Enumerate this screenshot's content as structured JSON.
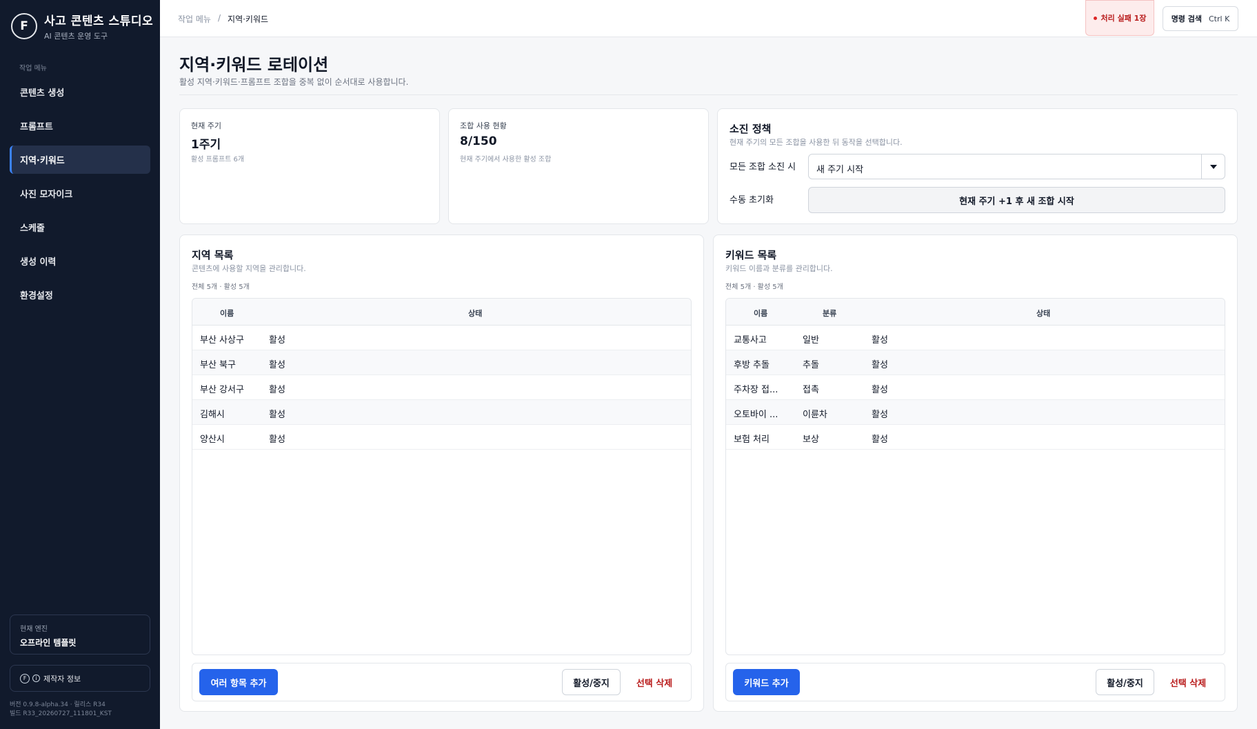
{
  "app": {
    "logo_text": "F",
    "title": "사고 콘텐츠 스튜디오",
    "subtitle": "AI 콘텐츠 운영 도구"
  },
  "sidebar": {
    "section_label": "작업 메뉴",
    "items": [
      {
        "label": "콘텐츠 생성"
      },
      {
        "label": "프롬프트"
      },
      {
        "label": "지역·키워드"
      },
      {
        "label": "사진 모자이크"
      },
      {
        "label": "스케줄"
      },
      {
        "label": "생성 이력"
      },
      {
        "label": "환경설정"
      }
    ],
    "active_index": 2,
    "engine_label": "현재 엔진",
    "engine_value": "오프라인 템플릿",
    "maker_label": "제작자 정보",
    "version_line1": "버전 0.9.8-alpha.34 · 릴리스 R34",
    "version_line2": "빌드 R33_20260727_111801_KST"
  },
  "topbar": {
    "breadcrumb_parent": "작업 메뉴",
    "breadcrumb_sep": "/",
    "breadcrumb_current": "지역·키워드",
    "fail_badge": "처리 실패 1장",
    "command_label": "명령 검색",
    "command_shortcut": "Ctrl K"
  },
  "page": {
    "title": "지역·키워드 로테이션",
    "subtitle": "활성 지역·키워드·프롬프트 조합을 중복 없이 순서대로 사용합니다."
  },
  "stats": {
    "cycle": {
      "label": "현재 주기",
      "value": "1주기",
      "hint": "활성 프롬프트 6개"
    },
    "usage": {
      "label": "조합 사용 현황",
      "value": "8/150",
      "hint": "현재 주기에서 사용한 활성 조합"
    }
  },
  "policy": {
    "title": "소진 정책",
    "desc": "현재 주기의 모든 조합을 사용한 뒤 동작을 선택합니다.",
    "exhaust_label": "모든 조합 소진 시",
    "exhaust_value": "새 주기 시작",
    "reset_label": "수동 초기화",
    "reset_button": "현재 주기 +1 후 새 조합 시작"
  },
  "regions": {
    "title": "지역 목록",
    "desc": "콘텐츠에 사용할 지역을 관리합니다.",
    "count": "전체 5개 · 활성 5개",
    "columns": [
      "이름",
      "상태"
    ],
    "rows": [
      {
        "name": "부산 사상구",
        "status": "활성"
      },
      {
        "name": "부산 북구",
        "status": "활성"
      },
      {
        "name": "부산 강서구",
        "status": "활성"
      },
      {
        "name": "김해시",
        "status": "활성"
      },
      {
        "name": "양산시",
        "status": "활성"
      }
    ],
    "add_button": "여러 항목 추가",
    "toggle_button": "활성/중지",
    "delete_button": "선택 삭제"
  },
  "keywords": {
    "title": "키워드 목록",
    "desc": "키워드 이름과 분류를 관리합니다.",
    "count": "전체 5개 · 활성 5개",
    "columns": [
      "이름",
      "분류",
      "상태"
    ],
    "rows": [
      {
        "name": "교통사고",
        "category": "일반",
        "status": "활성"
      },
      {
        "name": "후방 추돌",
        "category": "추돌",
        "status": "활성"
      },
      {
        "name": "주차장 접...",
        "category": "접촉",
        "status": "활성"
      },
      {
        "name": "오토바이 ...",
        "category": "이륜차",
        "status": "활성"
      },
      {
        "name": "보험 처리",
        "category": "보상",
        "status": "활성"
      }
    ],
    "add_button": "키워드 추가",
    "toggle_button": "활성/중지",
    "delete_button": "선택 삭제"
  },
  "colors": {
    "sidebar_bg": "#111a2c",
    "primary": "#2563eb",
    "danger": "#b91c1c"
  }
}
